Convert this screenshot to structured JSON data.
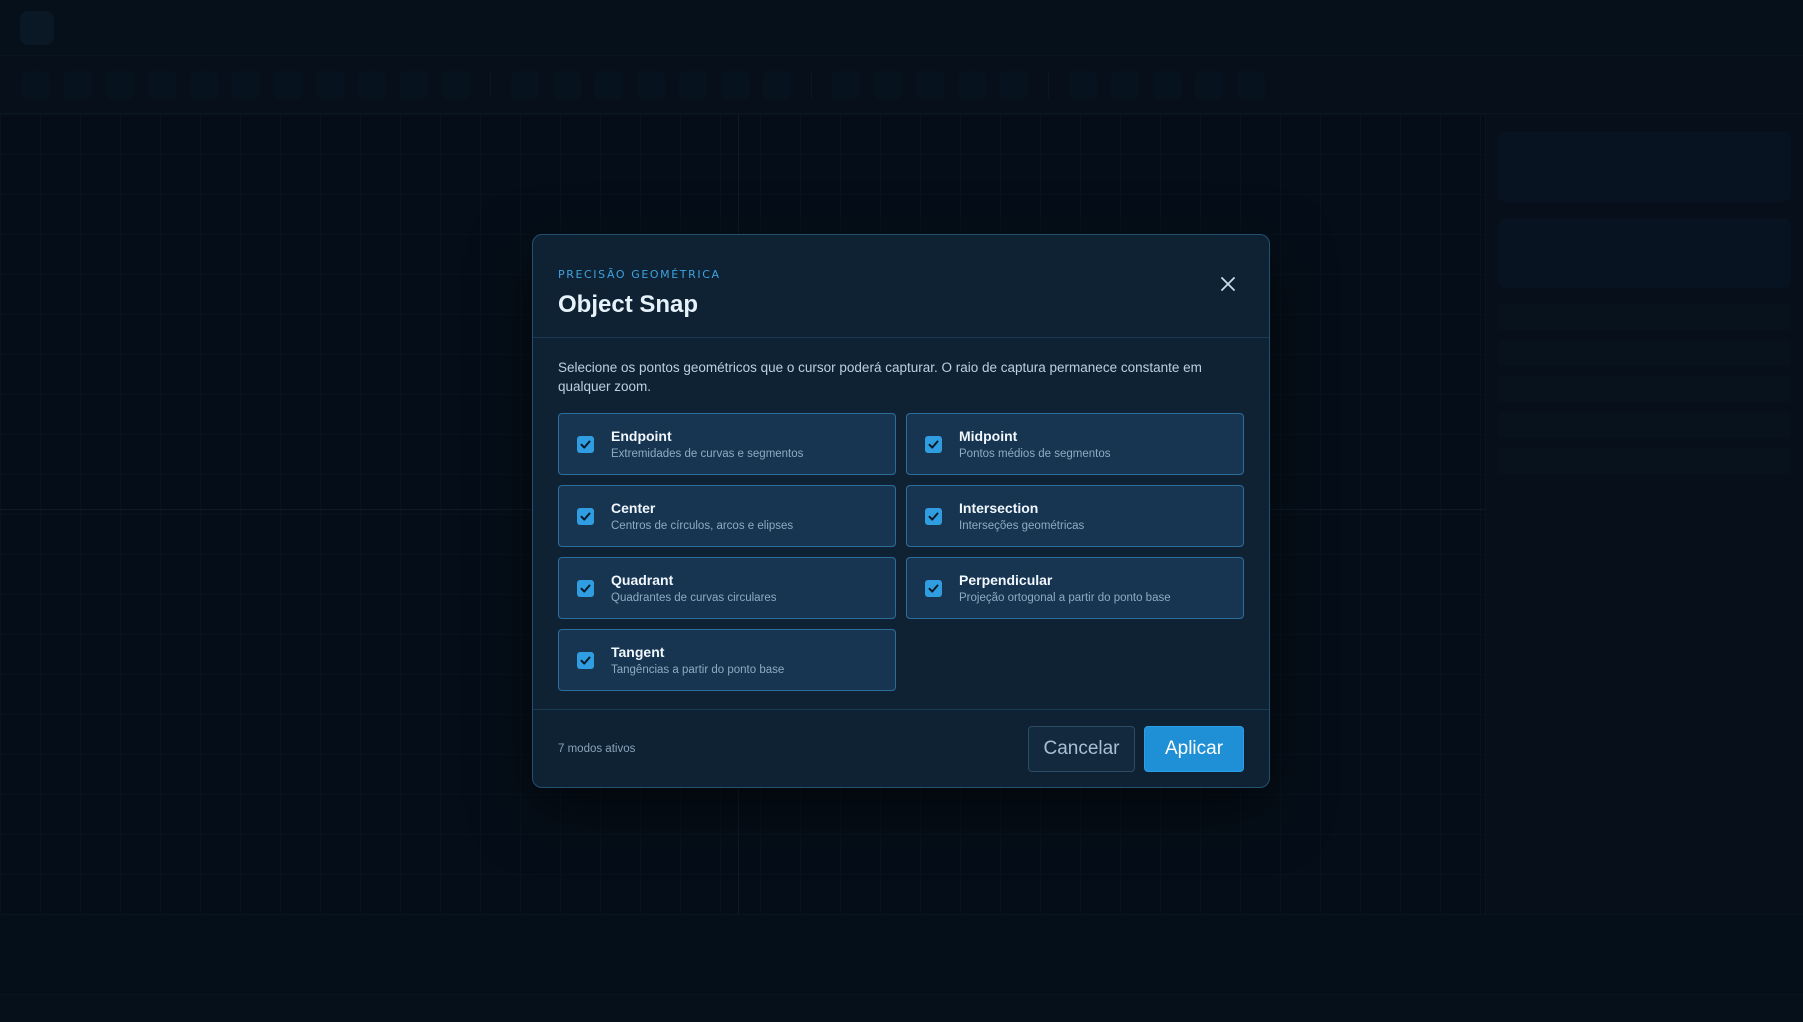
{
  "dialog": {
    "eyebrow": "PRECISÃO GEOMÉTRICA",
    "title": "Object Snap",
    "close_icon": "close-icon",
    "description": "Selecione os pontos geométricos que o cursor poderá capturar. O raio de captura permanece constante em qualquer zoom.",
    "options": [
      {
        "label": "Endpoint",
        "sublabel": "Extremidades de curvas e segmentos",
        "checked": true
      },
      {
        "label": "Midpoint",
        "sublabel": "Pontos médios de segmentos",
        "checked": true
      },
      {
        "label": "Center",
        "sublabel": "Centros de círculos, arcos e elipses",
        "checked": true
      },
      {
        "label": "Intersection",
        "sublabel": "Interseções geométricas",
        "checked": true
      },
      {
        "label": "Quadrant",
        "sublabel": "Quadrantes de curvas circulares",
        "checked": true
      },
      {
        "label": "Perpendicular",
        "sublabel": "Projeção ortogonal a partir do ponto base",
        "checked": true
      },
      {
        "label": "Tangent",
        "sublabel": "Tangências a partir do ponto base",
        "checked": true
      }
    ],
    "status": "7 modos ativos",
    "cancel_label": "Cancelar",
    "apply_label": "Aplicar"
  },
  "colors": {
    "accent": "#1f8fd6",
    "check": "#2f9de0",
    "eyebrow": "#3da3e0",
    "option_bg": "#173550",
    "option_border": "#2c6d99"
  }
}
